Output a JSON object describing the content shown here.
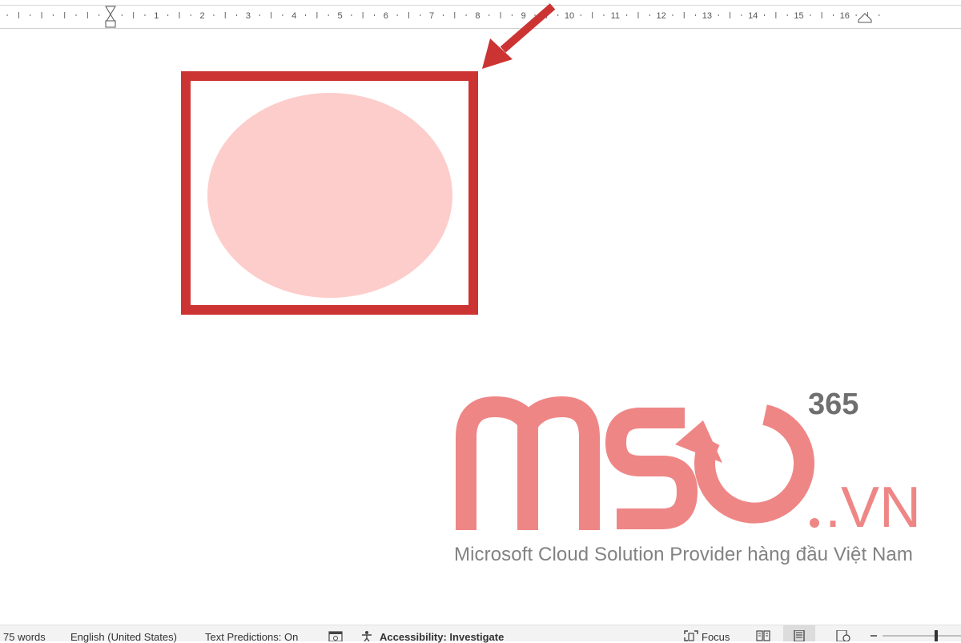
{
  "ruler": {
    "numbers": [
      "1",
      "2",
      "3",
      "4",
      "5",
      "6",
      "7",
      "8",
      "9",
      "10",
      "11",
      "12",
      "13",
      "14",
      "15",
      "16"
    ]
  },
  "logo": {
    "wordmark": "MSO",
    "superscript": "365",
    "suffix": ".VN",
    "tagline": "Microsoft Cloud Solution Provider hàng đầu Việt Nam"
  },
  "statusbar": {
    "word_count": "75 words",
    "language": "English (United States)",
    "text_predictions": "Text Predictions: On",
    "accessibility": "Accessibility: Investigate",
    "focus": "Focus"
  },
  "colors": {
    "frame": "#cc3434",
    "ellipse_fill": "#fdcdcb",
    "logo": "#ef8686",
    "logo_365": "#6f6f6f",
    "tagline": "#828282"
  },
  "icons": {
    "ruler_indent": "hourglass-indent-marker",
    "ruler_right_indent": "triangle-indent-marker",
    "arrow": "red-arrow",
    "macro": "macro-recording-icon",
    "accessibility": "accessibility-person-icon",
    "focus": "focus-mode-icon",
    "read_mode": "read-mode-icon",
    "print_layout": "print-layout-icon",
    "web_layout": "web-layout-icon",
    "zoom_out": "minus-icon",
    "zoom_slider": "zoom-slider"
  }
}
